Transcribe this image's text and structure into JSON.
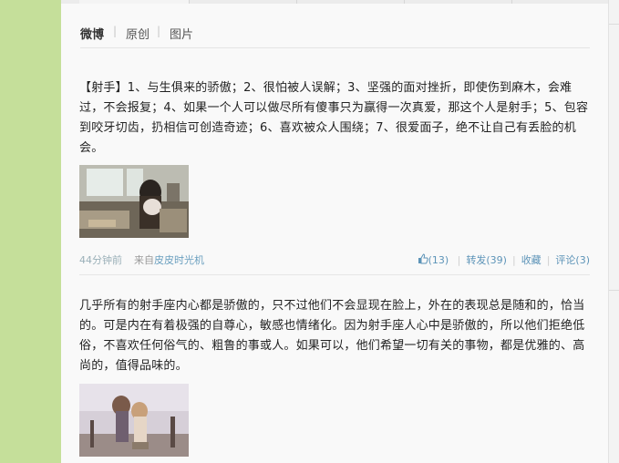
{
  "tabs": [
    "微博",
    "原创",
    "图片"
  ],
  "posts": [
    {
      "text": "【射手】1、与生俱来的骄傲；2、很怕被人误解；3、坚强的面对挫折，即使伤到麻木，会难过，不会报复；4、如果一个人可以做尽所有傻事只为赢得一次真爱，那这个人是射手；5、包容到咬牙切齿，扔相信可创造奇迹；6、喜欢被众人围绕；7、很爱面子，绝不让自己有丢脸的机会。",
      "time": "44分钟前",
      "from_prefix": "来自",
      "from_app": "皮皮时光机",
      "like_count": "(13)",
      "repost": "转发(39)",
      "favorite": "收藏",
      "comment": "评论(3)"
    },
    {
      "text": "几乎所有的射手座内心都是骄傲的，只不过他们不会显现在脸上，外在的表现总是随和的，恰当的。可是内在有着极强的自尊心，敏感也情绪化。因为射手座人心中是骄傲的，所以他们拒绝低俗，不喜欢任何俗气的、粗鲁的事或人。如果可以，他们希望一切有关的事物，都是优雅的、高尚的，值得品味的。"
    }
  ],
  "icons": {
    "like": "thumbs-up-icon"
  },
  "colors": {
    "background": "#c5df9a",
    "panel": "#f9f9f9",
    "link": "#5d94b8"
  }
}
